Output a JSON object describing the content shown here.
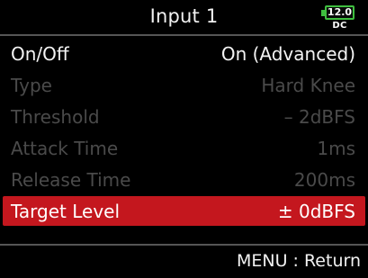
{
  "header": {
    "title": "Input 1",
    "battery": {
      "voltage": "12.0",
      "source": "DC",
      "color": "#3fbf3f"
    }
  },
  "menu": {
    "items": [
      {
        "label": "On/Off",
        "value": "On (Advanced)",
        "state": "enabled"
      },
      {
        "label": "Type",
        "value": "Hard Knee",
        "state": "disabled"
      },
      {
        "label": "Threshold",
        "value": "– 2dBFS",
        "state": "disabled"
      },
      {
        "label": "Attack Time",
        "value": "1ms",
        "state": "disabled"
      },
      {
        "label": "Release Time",
        "value": "200ms",
        "state": "disabled"
      },
      {
        "label": "Target Level",
        "value": "± 0dBFS",
        "state": "selected"
      }
    ],
    "selected_color": "#c4171e"
  },
  "footer": {
    "hint": "MENU : Return"
  }
}
